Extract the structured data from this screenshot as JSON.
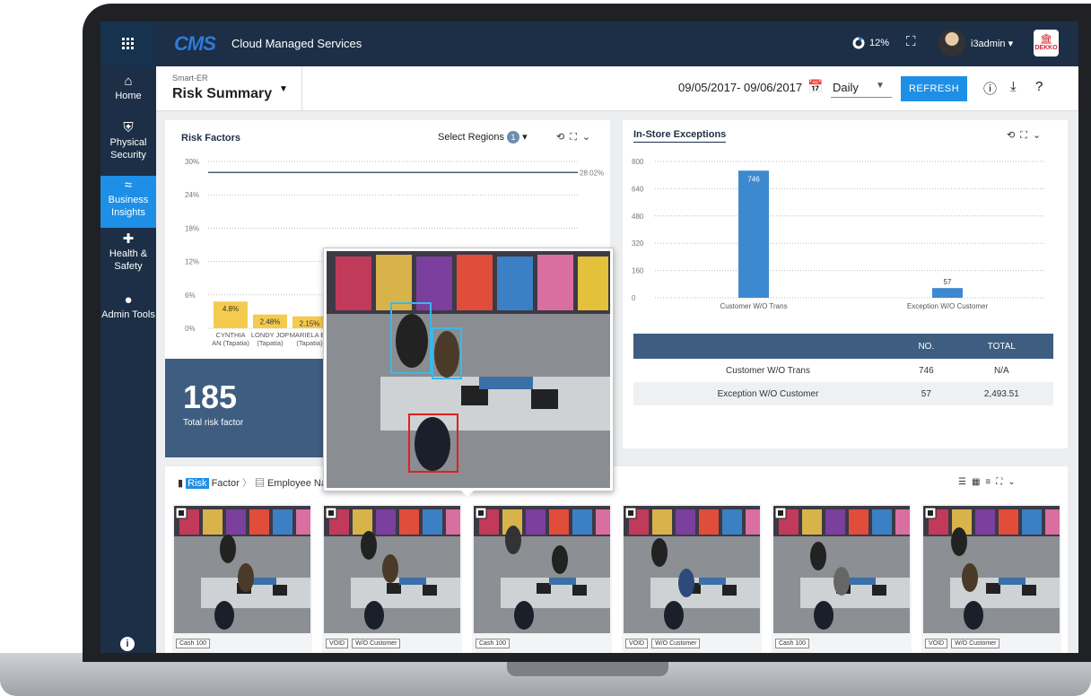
{
  "app": {
    "logo": "CMS",
    "name": "Cloud Managed Services",
    "cpu": "12%",
    "user": "i3admin",
    "brand": "DEKKO"
  },
  "sidebar": {
    "items": [
      {
        "label": "Home",
        "icon": "home-icon"
      },
      {
        "label": "Physical Security",
        "icon": "shield-icon"
      },
      {
        "label": "Business Insights",
        "icon": "trend-icon",
        "active": true
      },
      {
        "label": "Health & Safety",
        "icon": "cross-icon"
      },
      {
        "label": "Admin Tools",
        "icon": "user-icon"
      }
    ]
  },
  "header": {
    "breadcrumb": "Smart-ER",
    "title": "Risk Summary",
    "daterange": "09/05/2017- 09/06/2017",
    "period": "Daily",
    "refresh": "REFRESH"
  },
  "risk_factors": {
    "title": "Risk Factors",
    "select_regions": "Select Regions",
    "region_count": "1",
    "total": "185",
    "total_label": "Total risk factor"
  },
  "exceptions": {
    "title": "In-Store Exceptions",
    "table": {
      "headers": [
        "",
        "NO.",
        "TOTAL"
      ],
      "rows": [
        [
          "Customer W/O Trans",
          "746",
          "N/A"
        ],
        [
          "Exception W/O Customer",
          "57",
          "2,493.51"
        ]
      ]
    }
  },
  "bottom": {
    "crumb_1": "Risk",
    "crumb_1b": " Factor",
    "crumb_2": "Employee Nar",
    "thumbs": [
      {
        "tags": [
          "Cash 100"
        ]
      },
      {
        "tags": [
          "VOID",
          "W/O Customer"
        ]
      },
      {
        "tags": [
          "Cash 100"
        ]
      },
      {
        "tags": [
          "VOID",
          "W/O Customer"
        ]
      },
      {
        "tags": [
          "Cash 100"
        ]
      },
      {
        "tags": [
          "VOID",
          "W/O Customer"
        ]
      }
    ]
  },
  "chart_data": [
    {
      "type": "bar",
      "title": "Risk Factors",
      "categories": [
        "CYNTHIA AN (Tapatia)",
        "LONDY JOP (Tapatia)",
        "MARIELA BE (Tapatia)"
      ],
      "category_lines": [
        [
          "CYNTHIA",
          "AN (Tapatia)"
        ],
        [
          "LONDY JOP",
          "(Tapatia)"
        ],
        [
          "MARIELA BE",
          "(Tapatia)"
        ]
      ],
      "values": [
        4.8,
        2.48,
        2.15
      ],
      "value_labels": [
        "4.8%",
        "2.48%",
        "2.15%"
      ],
      "yticks": [
        "0%",
        "6%",
        "12%",
        "18%",
        "24%",
        "30%"
      ],
      "ylim": [
        0,
        30
      ],
      "reference_line": {
        "value": 28.02,
        "label": "28.02%"
      },
      "bar_color": "#f5cb4e",
      "grid": true
    },
    {
      "type": "bar",
      "title": "In-Store Exceptions",
      "categories": [
        "Customer W/O Trans",
        "Exception W/O Customer"
      ],
      "values": [
        746,
        57
      ],
      "yticks": [
        "0",
        "160",
        "320",
        "480",
        "640",
        "800"
      ],
      "ylim": [
        0,
        800
      ],
      "bar_color": "#3d89d0",
      "grid": true
    }
  ]
}
